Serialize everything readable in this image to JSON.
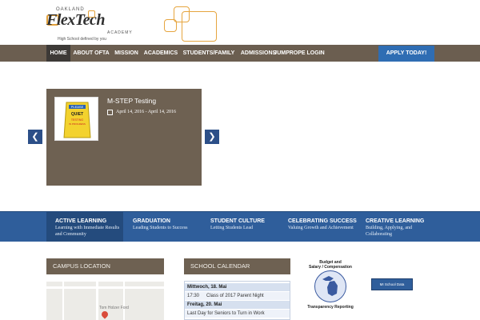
{
  "logo": {
    "top_text": "OAKLAND",
    "brand_text": "FlexTech",
    "sub_text": "ACADEMY",
    "tagline": "High School defined by you"
  },
  "nav": {
    "items": [
      {
        "label": "HOME",
        "active": true
      },
      {
        "label": "ABOUT OFTA",
        "active": false
      },
      {
        "label": "MISSION",
        "active": false
      },
      {
        "label": "ACADEMICS",
        "active": false
      },
      {
        "label": "STUDENTS/FAMILY",
        "active": false
      },
      {
        "label": "ADMISSIONS",
        "active": false
      },
      {
        "label": "JUMPROPE LOGIN",
        "active": false
      }
    ],
    "apply_label": "APPLY TODAY!"
  },
  "slider": {
    "title": "M-STEP Testing",
    "date": "April 14, 2016 - April 14, 2016",
    "prev_icon": "chevron-left-icon",
    "next_icon": "chevron-right-icon",
    "sign_text": [
      "PLEASE",
      "QUIET",
      "TESTING",
      "IN PROGRESS"
    ]
  },
  "band": {
    "items": [
      {
        "title": "ACTIVE LEARNING",
        "sub": "Learning with Immediate Results and Community",
        "active": true
      },
      {
        "title": "GRADUATION",
        "sub": "Leading Students to Success",
        "active": false
      },
      {
        "title": "STUDENT CULTURE",
        "sub": "Letting Students Lead",
        "active": false
      },
      {
        "title": "CELEBRATING SUCCESS",
        "sub": "Valuing Growth and Achievement",
        "active": false
      },
      {
        "title": "CREATIVE LEARNING",
        "sub": "Building, Applying, and Collaborating",
        "active": false
      }
    ]
  },
  "widgets": {
    "campus_title": "CAMPUS LOCATION",
    "calendar_title": "SCHOOL CALENDAR",
    "map_labels": [
      "Tom Holzer Ford"
    ]
  },
  "calendar": {
    "rows": [
      {
        "type": "day",
        "text": "Mittwoch, 18. Mai"
      },
      {
        "type": "event",
        "time": "17:30",
        "text": "Class of 2017 Parent Night"
      },
      {
        "type": "day",
        "text": "Freitag, 20. Mai"
      },
      {
        "type": "event",
        "time": "",
        "text": "Last Day for Seniors to Turn in Work"
      }
    ]
  },
  "budget": {
    "line1": "Budget and",
    "line2": "Salary / Compensation",
    "line3": "Transparency Reporting",
    "school_data_label": "MI School Data"
  },
  "colors": {
    "nav_bg": "#6b5e50",
    "accent_blue": "#2f6db3",
    "band_blue": "#2f5e9b",
    "logo_orange": "#e3a13b"
  }
}
